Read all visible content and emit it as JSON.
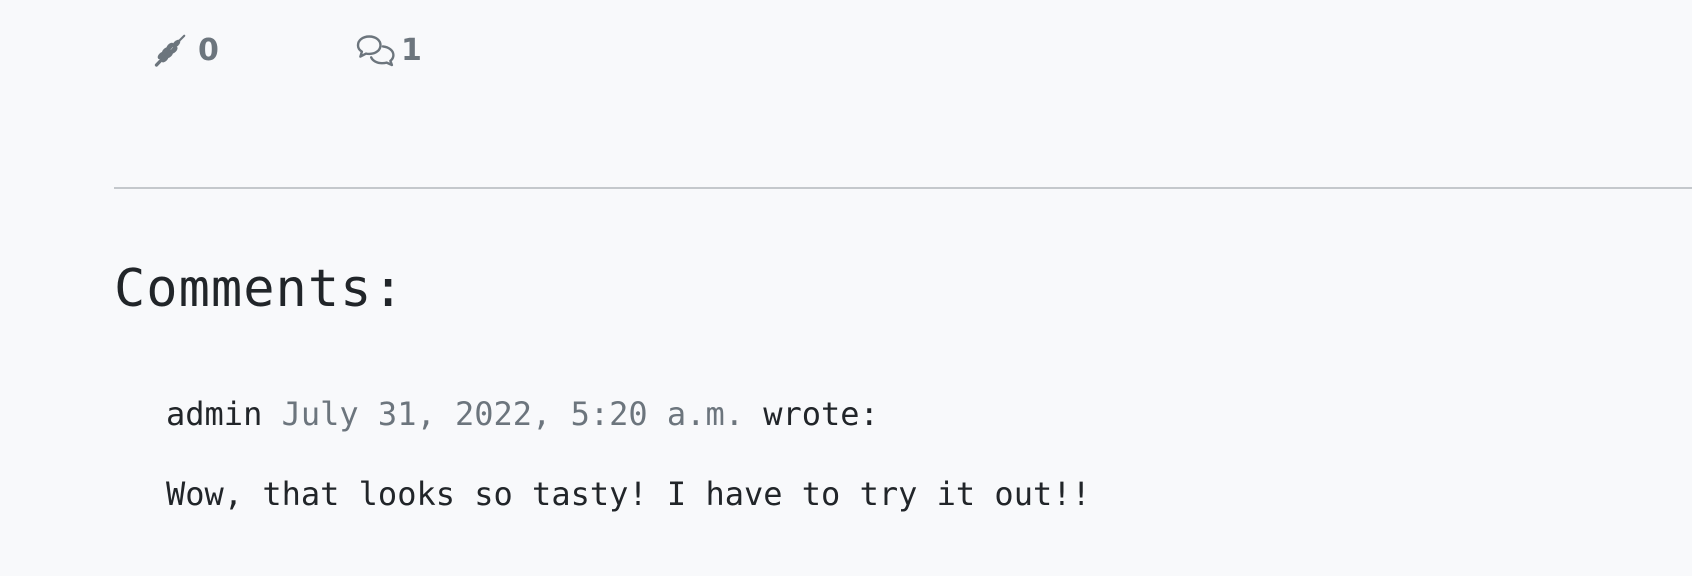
{
  "stats": {
    "likes_count": "0",
    "comments_count": "1"
  },
  "comments_section": {
    "heading": "Comments:",
    "items": [
      {
        "author": "admin",
        "date": "July 31, 2022, 5:20 a.m.",
        "wrote_label": "wrote:",
        "body": "Wow, that looks so tasty! I have to try it out!!"
      }
    ]
  },
  "colors": {
    "background": "#f8f9fb",
    "muted": "#6c757d",
    "text": "#212529",
    "divider": "#c4c8cc"
  },
  "icons": {
    "likes": "wheat-icon",
    "comments": "chat-bubbles-icon"
  }
}
